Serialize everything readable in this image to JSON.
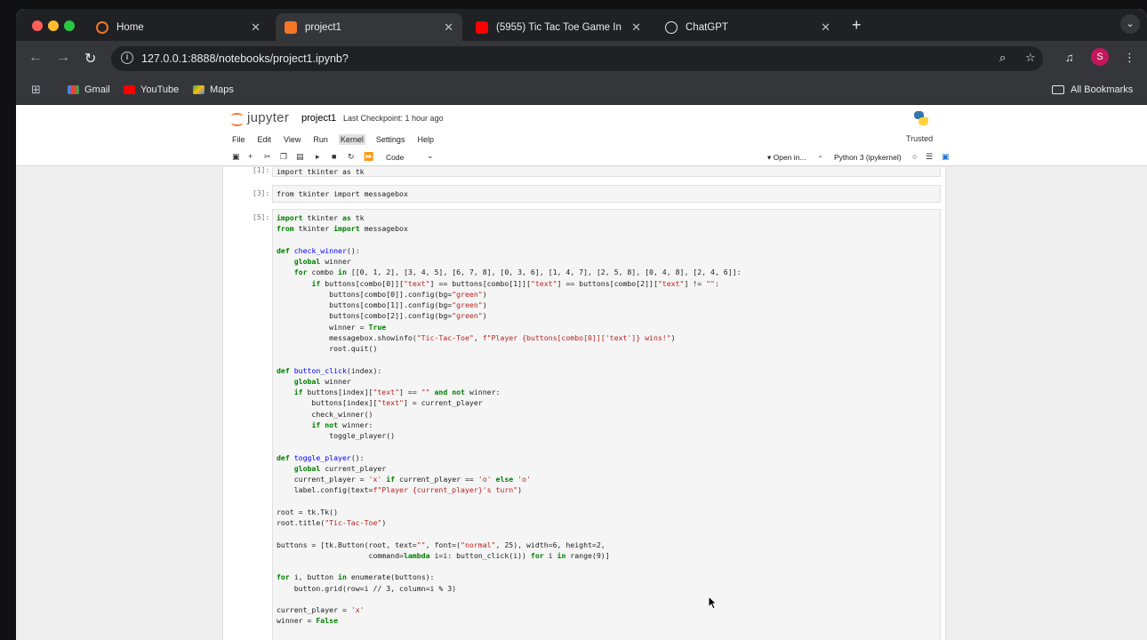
{
  "browser": {
    "tabs": [
      {
        "label": "Home",
        "icon": "jupyter-icon"
      },
      {
        "label": "project1",
        "icon": "jupyter-notebook-icon"
      },
      {
        "label": "(5955) Tic Tac Toe Game In P",
        "icon": "youtube-icon"
      },
      {
        "label": "ChatGPT",
        "icon": "chatgpt-icon"
      }
    ],
    "new_tab": "+",
    "url": "127.0.0.1:8888/notebooks/project1.ipynb?",
    "profile_initial": "S",
    "bookmarks": [
      {
        "label": "Gmail",
        "icon": "gmail-icon"
      },
      {
        "label": "YouTube",
        "icon": "youtube-icon"
      },
      {
        "label": "Maps",
        "icon": "maps-icon"
      }
    ],
    "all_bookmarks": "All Bookmarks"
  },
  "jupyter": {
    "brand": "jupyter",
    "notebook_title": "project1",
    "checkpoint": "Last Checkpoint: 1 hour ago",
    "trusted": "Trusted",
    "menu": [
      "File",
      "Edit",
      "View",
      "Run",
      "Kernel",
      "Settings",
      "Help"
    ],
    "cell_type": "Code",
    "open_in": "Open in...",
    "kernel": "Python 3 (ipykernel)"
  },
  "cells": [
    {
      "prompt": "[1]:",
      "code": "import tkinter as tk"
    },
    {
      "prompt": "[3]:",
      "code": "from tkinter import messagebox"
    },
    {
      "prompt": "[5]:"
    }
  ]
}
